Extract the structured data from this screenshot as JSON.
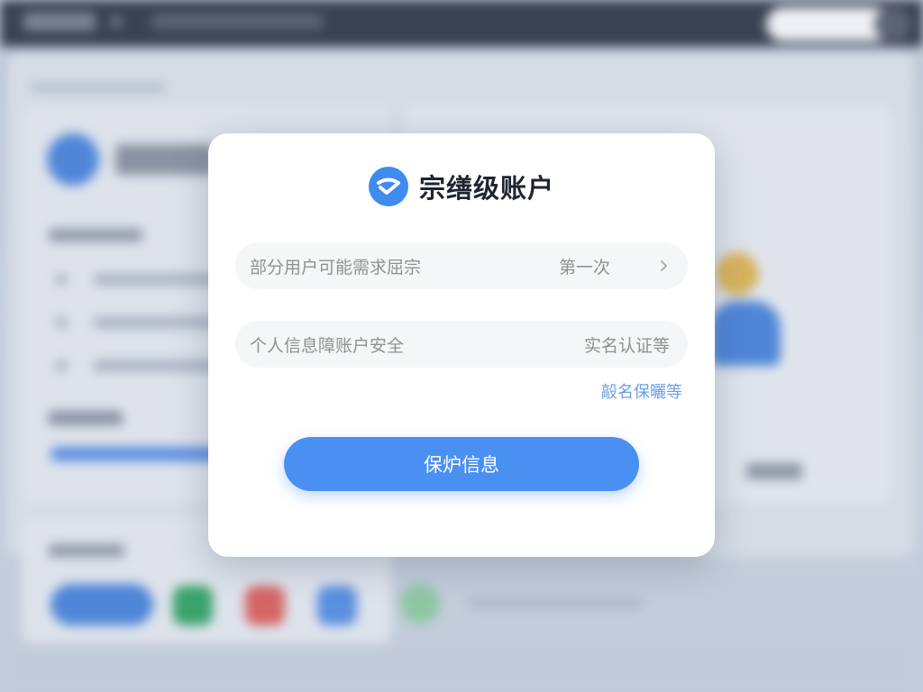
{
  "modal": {
    "title": "宗缮级账户",
    "logo_icon": "shield-check-icon",
    "fields": [
      {
        "label": "部分用户可能需求屈宗",
        "value": "第一次",
        "has_chevron": true
      },
      {
        "label": "个人信息障账户安全",
        "value": "实名认证等",
        "has_chevron": false
      }
    ],
    "link_text": "毃名保曬等",
    "primary_button": "保炉信息"
  },
  "colors": {
    "accent": "#4a8ff2",
    "link": "#6a9fe6",
    "modal_bg": "#ffffff",
    "field_bg": "#f5f6f8",
    "text_muted": "#8f9196",
    "title": "#1f2430"
  }
}
